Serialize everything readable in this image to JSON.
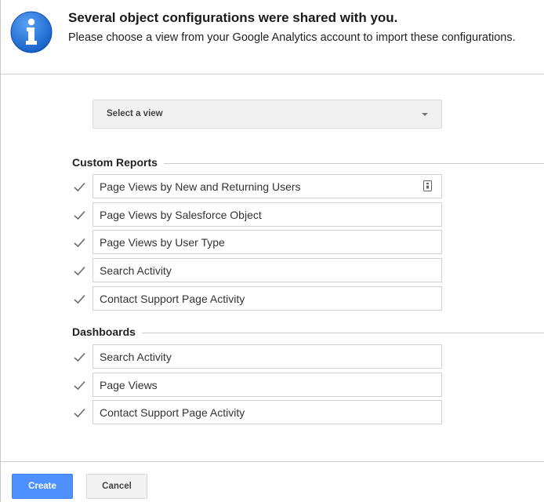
{
  "header": {
    "title": "Several object configurations were shared with you.",
    "subtitle": "Please choose a view from your Google Analytics account to import these configurations.",
    "icon": "info-icon",
    "icon_color": "#1a73e8"
  },
  "view_select": {
    "label": "Select a view",
    "icon": "chevron-down-icon"
  },
  "custom_reports": {
    "heading": "Custom Reports",
    "items": [
      {
        "label": "Page Views by New and Returning Users",
        "checked": true
      },
      {
        "label": "Page Views by Salesforce Object",
        "checked": true
      },
      {
        "label": "Page Views by User Type",
        "checked": true
      },
      {
        "label": "Search Activity",
        "checked": true
      },
      {
        "label": "Contact Support Page Activity",
        "checked": true
      }
    ]
  },
  "dashboards": {
    "heading": "Dashboards",
    "items": [
      {
        "label": "Search Activity",
        "checked": true
      },
      {
        "label": "Page Views",
        "checked": true
      },
      {
        "label": "Contact Support Page Activity",
        "checked": true
      }
    ]
  },
  "footer": {
    "create_label": "Create",
    "cancel_label": "Cancel",
    "create_color": "#4d90fe"
  }
}
